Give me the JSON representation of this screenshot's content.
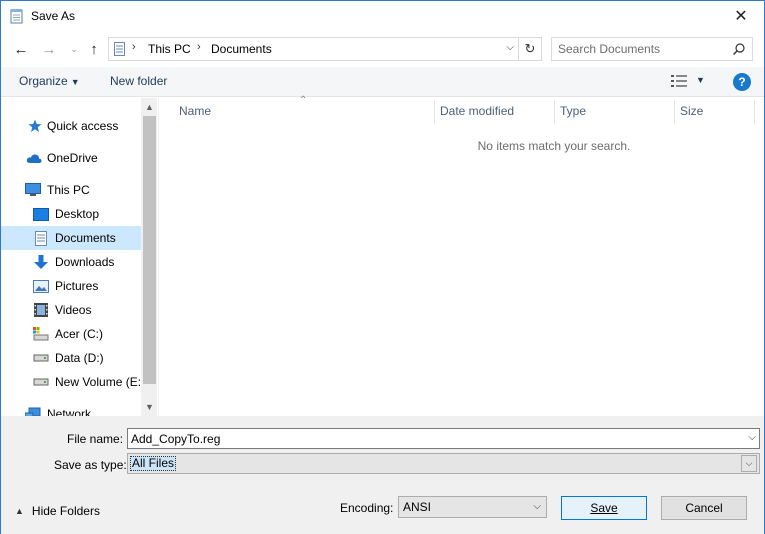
{
  "window": {
    "title": "Save As",
    "accent": "#2b79d0"
  },
  "nav": {
    "back_icon": "arrow-left-icon",
    "forward_icon": "arrow-right-icon",
    "recent_icon": "chevron-down-icon",
    "up_icon": "arrow-up-icon"
  },
  "address": {
    "segments": [
      "This PC",
      "Documents"
    ]
  },
  "search": {
    "placeholder": "Search Documents"
  },
  "toolbar": {
    "organize_label": "Organize",
    "new_folder_label": "New folder",
    "help_label": "?"
  },
  "sidebar": {
    "items": [
      {
        "label": "Quick access",
        "icon": "star-icon"
      },
      {
        "label": "OneDrive",
        "icon": "cloud-icon"
      },
      {
        "label": "This PC",
        "icon": "computer-icon"
      },
      {
        "label": "Desktop",
        "icon": "desktop-icon"
      },
      {
        "label": "Documents",
        "icon": "document-icon",
        "selected": true
      },
      {
        "label": "Downloads",
        "icon": "download-icon"
      },
      {
        "label": "Pictures",
        "icon": "pictures-icon"
      },
      {
        "label": "Videos",
        "icon": "videos-icon"
      },
      {
        "label": "Acer (C:)",
        "icon": "drive-icon"
      },
      {
        "label": "Data (D:)",
        "icon": "drive-icon"
      },
      {
        "label": "New Volume (E:)",
        "icon": "drive-icon"
      },
      {
        "label": "Network",
        "icon": "network-icon"
      }
    ]
  },
  "filelist": {
    "columns": [
      "Name",
      "Date modified",
      "Type",
      "Size"
    ],
    "empty_message": "No items match your search."
  },
  "form": {
    "file_name_label": "File name:",
    "file_name_value": "Add_CopyTo.reg",
    "save_type_label": "Save as type:",
    "save_type_value": "All Files",
    "encoding_label": "Encoding:",
    "encoding_value": "ANSI",
    "hide_folders_label": "Hide Folders",
    "save_label": "Save",
    "cancel_label": "Cancel"
  }
}
